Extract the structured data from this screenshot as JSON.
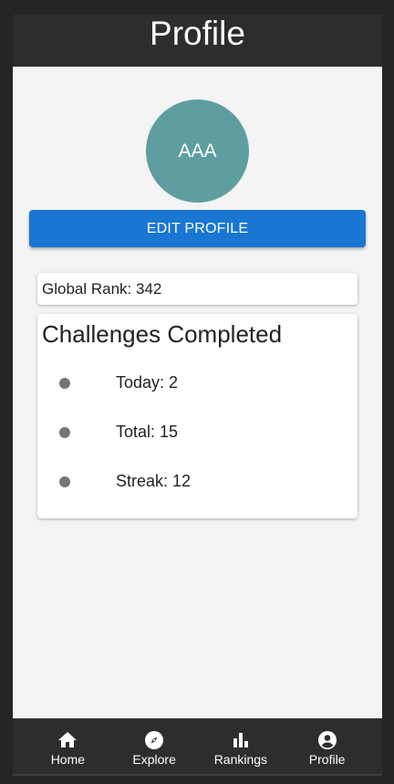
{
  "header": {
    "title": "Profile"
  },
  "profile": {
    "avatar_initials": "AAA",
    "avatar_color": "#5f9ea0",
    "edit_button_label": "EDIT PROFILE"
  },
  "rank": {
    "text": "Global Rank: 342"
  },
  "challenges": {
    "title": "Challenges Completed",
    "items": [
      {
        "label": "Today: 2"
      },
      {
        "label": "Total: 15"
      },
      {
        "label": "Streak: 12"
      }
    ]
  },
  "bottom_nav": {
    "items": [
      {
        "label": "Home",
        "icon": "home-icon"
      },
      {
        "label": "Explore",
        "icon": "compass-icon"
      },
      {
        "label": "Rankings",
        "icon": "bar-chart-icon"
      },
      {
        "label": "Profile",
        "icon": "account-circle-icon"
      }
    ]
  },
  "colors": {
    "accent": "#1976d2",
    "header_bg": "#2d2d2d",
    "page_bg": "#f4f4f4"
  }
}
